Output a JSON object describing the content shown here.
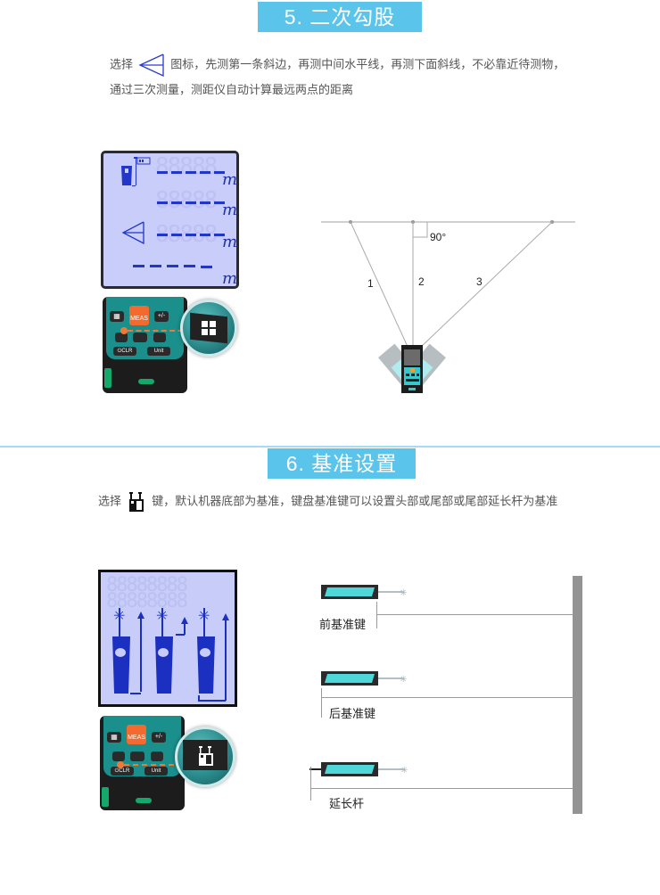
{
  "section5": {
    "title": "5. 二次勾股",
    "desc_line1_before_icon": "选择",
    "desc_line1_after_icon": "图标，先测第一条斜边，再测中间水平线，再测下面斜线，不必靠近待测物，",
    "desc_line2": "通过三次测量，测距仪自动计算最远两点的距离",
    "icon": "triangle-pythagoras-icon",
    "lcd": {
      "rows": [
        "-----",
        "-----",
        "-----",
        "-----"
      ],
      "unit": "m"
    },
    "keypad": {
      "meas_label": "MEAS",
      "clr_label": "CLR",
      "unit_label": "Unit",
      "plusminus_label": "+/-",
      "highlight_icon": "function-grid-icon"
    },
    "diagram": {
      "angle_label": "90°",
      "line_labels": [
        "1",
        "2",
        "3"
      ]
    }
  },
  "section6": {
    "title": "6. 基准设置",
    "desc_before_icon": "选择",
    "desc_after_icon": "键，默认机器底部为基准，键盘基准键可以设置头部或尾部或尾部延长杆为基准",
    "icon": "reference-key-icon",
    "keypad": {
      "meas_label": "MEAS",
      "clr_label": "CLR",
      "unit_label": "Unit",
      "plusminus_label": "+/-",
      "highlight_icon": "reference-key-icon"
    },
    "diagram": {
      "labels": [
        "前基准键",
        "后基准键",
        "延长杆"
      ]
    }
  }
}
